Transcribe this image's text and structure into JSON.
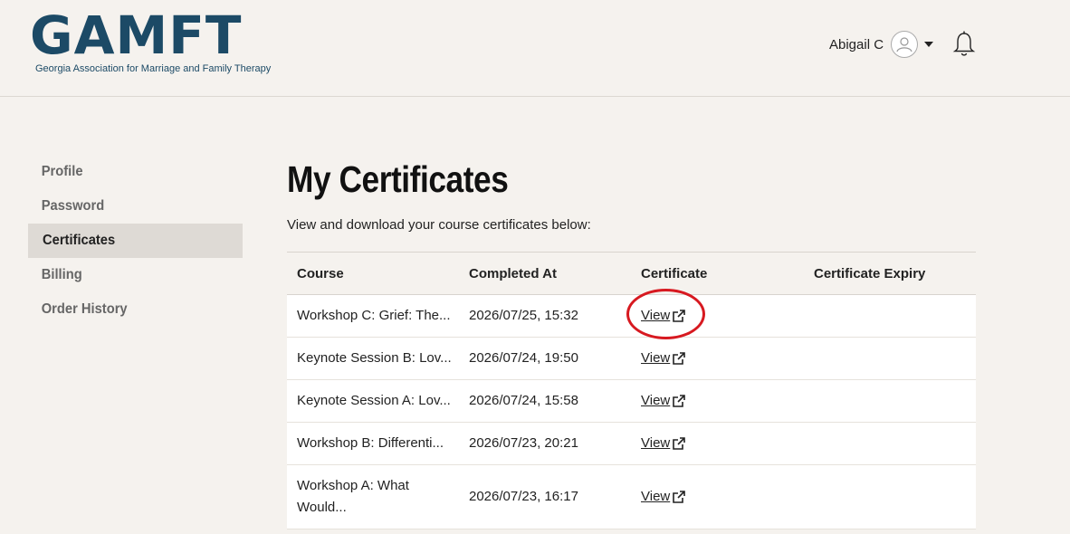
{
  "header": {
    "logo_text": "GAMFT",
    "logo_subtitle": "Georgia Association for Marriage and Family Therapy",
    "user_name": "Abigail C",
    "icons": [
      "avatar-icon",
      "chevron-down-icon",
      "bell-icon"
    ]
  },
  "sidebar": {
    "items": [
      {
        "label": "Profile"
      },
      {
        "label": "Password"
      },
      {
        "label": "Certificates"
      },
      {
        "label": "Billing"
      },
      {
        "label": "Order History"
      }
    ],
    "active": "Certificates"
  },
  "main": {
    "title": "My Certificates",
    "subtitle": "View and download your course certificates below:",
    "table": {
      "headers": [
        "Course",
        "Completed At",
        "Certificate",
        "Certificate Expiry"
      ],
      "rows": [
        {
          "course": "Workshop C: Grief: The...",
          "completed": "2026/07/25, 15:32",
          "certificate": "View",
          "expiry": ""
        },
        {
          "course": "Keynote Session B: Lov...",
          "completed": "2026/07/24, 19:50",
          "certificate": "View",
          "expiry": ""
        },
        {
          "course": "Keynote Session A: Lov...",
          "completed": "2026/07/24, 15:58",
          "certificate": "View",
          "expiry": ""
        },
        {
          "course": "Workshop B: Differenti...",
          "completed": "2026/07/23, 20:21",
          "certificate": "View",
          "expiry": ""
        },
        {
          "course": "Workshop A: What Would...",
          "completed": "2026/07/23, 16:17",
          "certificate": "View",
          "expiry": ""
        }
      ]
    }
  },
  "colors": {
    "brand": "#1c4a66",
    "background": "#f5f2ee",
    "active_nav": "#dedad5",
    "highlight": "#d71920"
  }
}
